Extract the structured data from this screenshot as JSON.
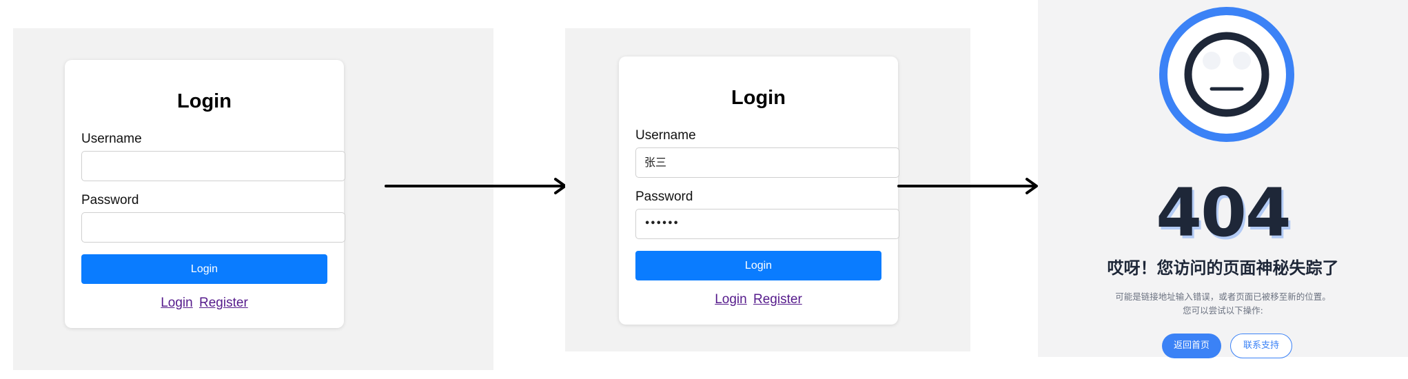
{
  "step1": {
    "title": "Login",
    "username_label": "Username",
    "username_value": "",
    "password_label": "Password",
    "password_value": "",
    "submit_label": "Login",
    "link_login": "Login",
    "link_register": "Register"
  },
  "step2": {
    "title": "Login",
    "username_label": "Username",
    "username_value": "张三",
    "password_label": "Password",
    "password_value": "••••••",
    "submit_label": "Login",
    "link_login": "Login",
    "link_register": "Register"
  },
  "error_page": {
    "code": "404",
    "headline": "哎呀！您访问的页面神秘失踪了",
    "description_line1": "可能是链接地址输入错误，或者页面已被移至新的位置。",
    "description_line2": "您可以尝试以下操作:",
    "home_button": "返回首页",
    "support_button": "联系支持",
    "icon": "neutral-face-icon"
  },
  "colors": {
    "primary_button": "#0a7cff",
    "link": "#551a8b",
    "accent_404": "#3b82f6",
    "dark_404": "#1e2738"
  }
}
